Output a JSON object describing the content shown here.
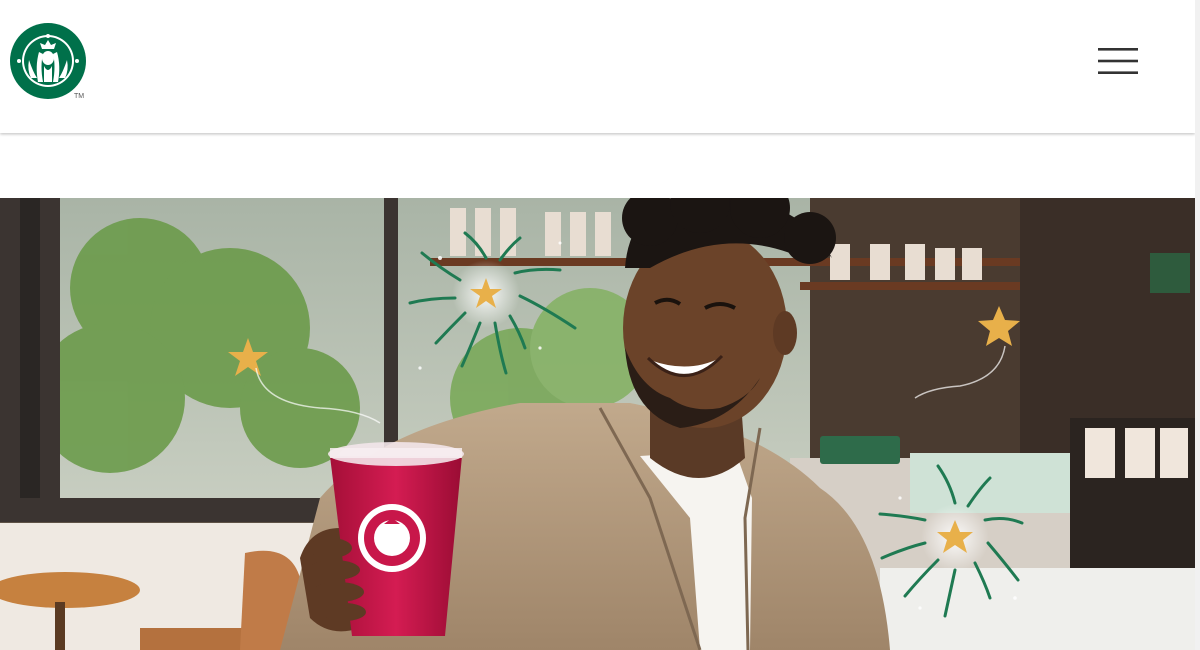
{
  "brand": {
    "name": "Starbucks",
    "logo_icon": "starbucks-siren-logo-icon",
    "trademark": "TM",
    "color_green": "#00704A",
    "color_white": "#ffffff"
  },
  "header": {
    "menu_icon": "hamburger-menu-icon"
  },
  "hero": {
    "image": "man-smiling-holding-pink-iced-drink-in-cafe",
    "decorations": [
      "gold-star-icon",
      "firework-burst-icon"
    ],
    "cup_color": "#c8174a",
    "accent_gold": "#e8b04a"
  }
}
